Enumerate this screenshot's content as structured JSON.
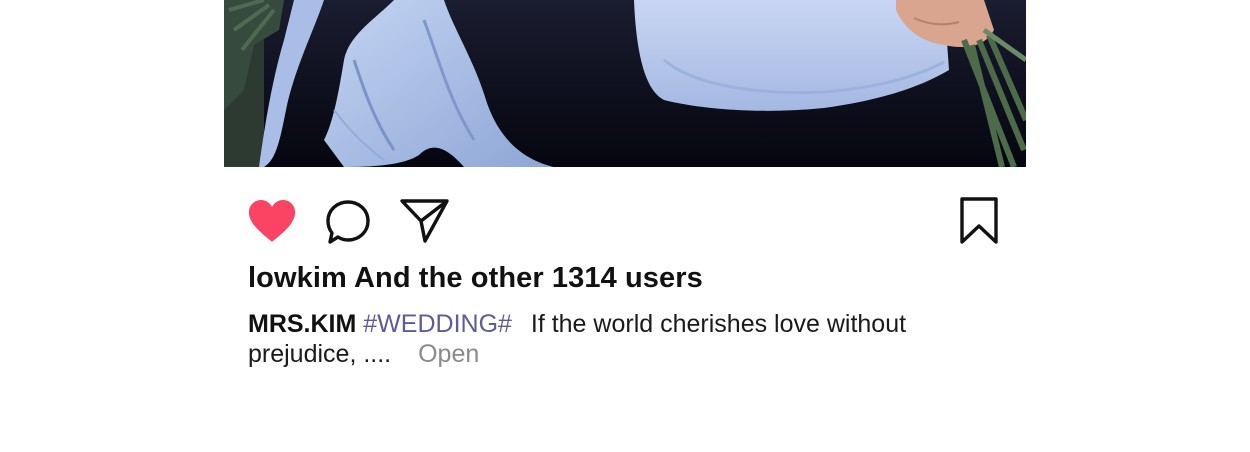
{
  "post": {
    "image_alt": "photo",
    "actions": {
      "like_icon": "heart-icon",
      "comment_icon": "speech-bubble-icon",
      "share_icon": "paper-plane-icon",
      "save_icon": "bookmark-icon",
      "liked": true
    },
    "likes_text": "lowkim And the other 1314 users",
    "caption": {
      "author": "MRS.KIM",
      "hashtag": "#WEDDING#",
      "text": "If the world cherishes love without prejudice, ....",
      "open_label": "Open"
    }
  },
  "colors": {
    "like_active": "#fb4463",
    "hashtag": "#5f5c95",
    "muted": "#8a8a8a"
  }
}
